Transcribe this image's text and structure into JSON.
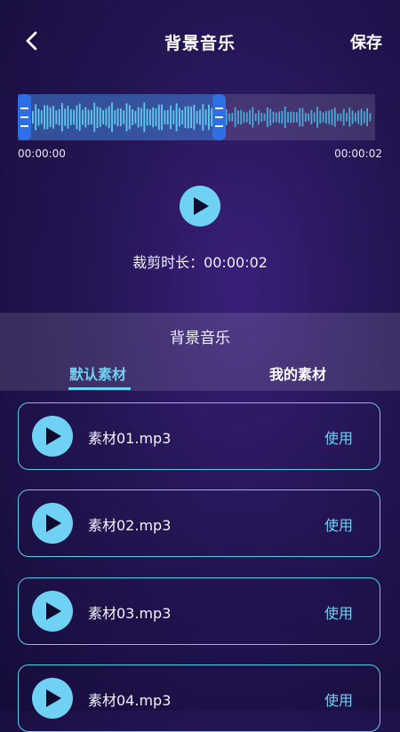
{
  "header": {
    "title": "背景音乐",
    "save_label": "保存"
  },
  "waveform": {
    "start_time": "00:00:00",
    "end_time": "00:00:02"
  },
  "duration_text": "裁剪时长：00:00:02",
  "panel": {
    "title": "背景音乐",
    "tabs": [
      {
        "label": "默认素材"
      },
      {
        "label": "我的素材"
      }
    ]
  },
  "list": [
    {
      "name": "素材01.mp3",
      "action": "使用"
    },
    {
      "name": "素材02.mp3",
      "action": "使用"
    },
    {
      "name": "素材03.mp3",
      "action": "使用"
    },
    {
      "name": "素材04.mp3",
      "action": "使用"
    }
  ],
  "colors": {
    "accent": "#6fd2f4",
    "handle": "#2f6fe6"
  }
}
